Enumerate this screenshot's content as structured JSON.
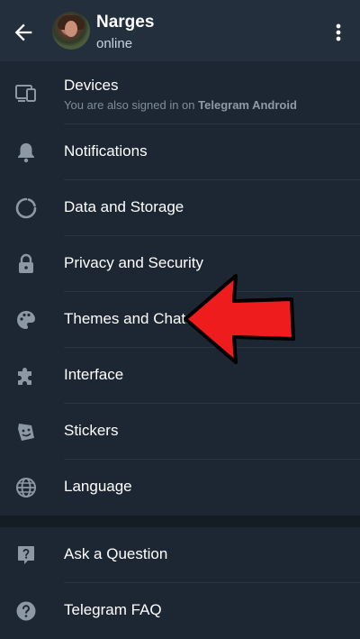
{
  "header": {
    "profile_name": "Narges",
    "profile_status": "online",
    "back_icon": "arrow-left-icon",
    "more_icon": "more-vertical-icon"
  },
  "menu": {
    "items": [
      {
        "label": "Devices",
        "sub": "You are also signed in on ",
        "sub_bold": "Telegram Android",
        "icon": "devices-icon"
      },
      {
        "label": "Notifications",
        "icon": "bell-icon"
      },
      {
        "label": "Data and Storage",
        "icon": "data-storage-icon"
      },
      {
        "label": "Privacy and Security",
        "icon": "lock-icon"
      },
      {
        "label": "Themes and Chats",
        "icon": "palette-icon"
      },
      {
        "label": "Interface",
        "icon": "puzzle-icon"
      },
      {
        "label": "Stickers",
        "icon": "sticker-icon"
      },
      {
        "label": "Language",
        "icon": "globe-icon"
      }
    ],
    "help_items": [
      {
        "label": "Ask a Question",
        "icon": "question-bubble-icon"
      },
      {
        "label": "Telegram FAQ",
        "icon": "question-circle-icon"
      }
    ]
  },
  "colors": {
    "background": "#1d2733",
    "header": "#232f3d",
    "icon": "#8c98a4",
    "annotation_arrow": "#ee1c1c"
  }
}
